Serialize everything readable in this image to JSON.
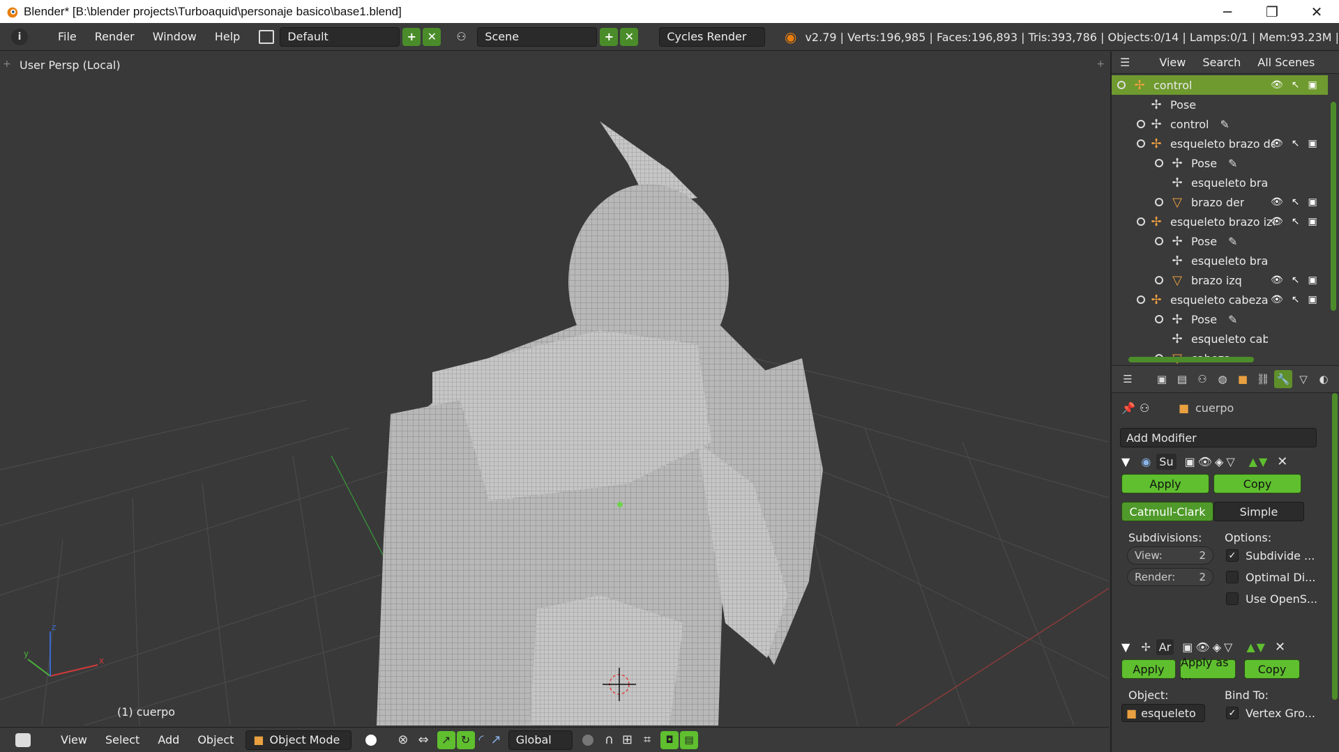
{
  "window": {
    "title": "Blender* [B:\\blender projects\\Turboaquid\\personaje basico\\base1.blend]",
    "minimize": "─",
    "restore": "❐",
    "close": "✕"
  },
  "infobar": {
    "menus": [
      "File",
      "Render",
      "Window",
      "Help"
    ],
    "layout": "Default",
    "scene": "Scene",
    "engine": "Cycles Render",
    "stats": "v2.79 | Verts:196,985 | Faces:196,893 | Tris:393,786 | Objects:0/14 | Lamps:0/1 | Mem:93.23M | cuerpo"
  },
  "viewport": {
    "label": "User Persp (Local)",
    "object_label": "(1) cuerpo",
    "axes": {
      "x": "x",
      "y": "y",
      "z": "z"
    }
  },
  "bottombar": {
    "menus": [
      "View",
      "Select",
      "Add",
      "Object"
    ],
    "mode": "Object Mode",
    "orientation": "Global"
  },
  "outliner": {
    "tabs": [
      "View",
      "Search",
      "All Scenes"
    ],
    "rows": [
      {
        "label": "control",
        "depth": 0,
        "selected": true
      },
      {
        "label": "Pose",
        "depth": 1
      },
      {
        "label": "control",
        "depth": 1
      },
      {
        "label": "esqueleto brazo de",
        "depth": 1
      },
      {
        "label": "Pose",
        "depth": 2
      },
      {
        "label": "esqueleto braz",
        "depth": 2
      },
      {
        "label": "brazo der",
        "depth": 2
      },
      {
        "label": "esqueleto brazo izc",
        "depth": 1
      },
      {
        "label": "Pose",
        "depth": 2
      },
      {
        "label": "esqueleto braz",
        "depth": 2
      },
      {
        "label": "brazo izq",
        "depth": 2
      },
      {
        "label": "esqueleto cabeza",
        "depth": 1
      },
      {
        "label": "Pose",
        "depth": 2
      },
      {
        "label": "esqueleto cabe",
        "depth": 2
      },
      {
        "label": "cabeza",
        "depth": 2
      }
    ]
  },
  "properties": {
    "object": "cuerpo",
    "add_modifier": "Add Modifier",
    "mod1": {
      "name": "Su",
      "apply": "Apply",
      "copy": "Copy",
      "type_a": "Catmull-Clark",
      "type_b": "Simple",
      "subdivisions": "Subdivisions:",
      "options": "Options:",
      "view_label": "View:",
      "view_value": "2",
      "render_label": "Render:",
      "render_value": "2",
      "opt1": "Subdivide ...",
      "opt2": "Optimal Di...",
      "opt3": "Use OpenS..."
    },
    "mod2": {
      "name": "Ar",
      "apply": "Apply",
      "apply_as": "Apply as ...",
      "copy": "Copy",
      "object_label": "Object:",
      "object_value": "esqueleto",
      "bind_to": "Bind To:",
      "bind_value": "Vertex Gro..."
    }
  },
  "colors": {
    "accent_green": "#5fbf2f",
    "selection": "#6f9a2f",
    "mesh": "#bdbdbd"
  }
}
